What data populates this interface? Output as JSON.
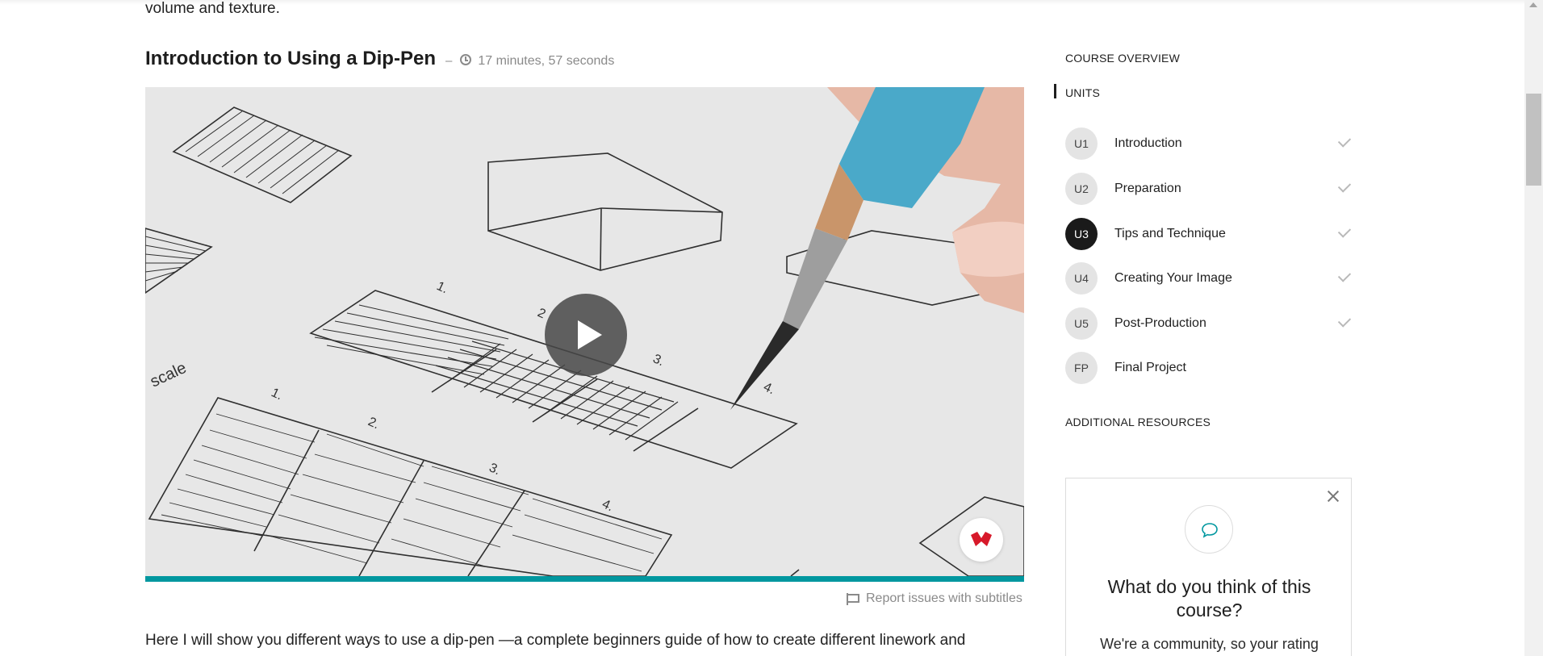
{
  "content": {
    "intro_text": "volume and texture.",
    "lesson": {
      "title": "Introduction to Using a Dip-Pen",
      "separator": "–",
      "duration": "17 minutes, 57 seconds"
    },
    "video": {
      "accent_color": "#00979f",
      "brand_color": "#d7192a"
    },
    "report_link": "Report issues with subtitles",
    "description": "Here I will show you different ways to use a dip-pen —a complete beginners guide of how to create different linework and"
  },
  "sidebar": {
    "course_overview": "COURSE OVERVIEW",
    "units_heading": "UNITS",
    "units": [
      {
        "badge": "U1",
        "label": "Introduction",
        "completed": true,
        "active": false
      },
      {
        "badge": "U2",
        "label": "Preparation",
        "completed": true,
        "active": false
      },
      {
        "badge": "U3",
        "label": "Tips and Technique",
        "completed": true,
        "active": true
      },
      {
        "badge": "U4",
        "label": "Creating Your Image",
        "completed": true,
        "active": false
      },
      {
        "badge": "U5",
        "label": "Post-Production",
        "completed": true,
        "active": false
      },
      {
        "badge": "FP",
        "label": "Final Project",
        "completed": false,
        "active": false
      }
    ],
    "additional_resources": "ADDITIONAL RESOURCES",
    "feedback": {
      "title": "What do you think of this course?",
      "body": "We're a community, so your rating"
    }
  }
}
